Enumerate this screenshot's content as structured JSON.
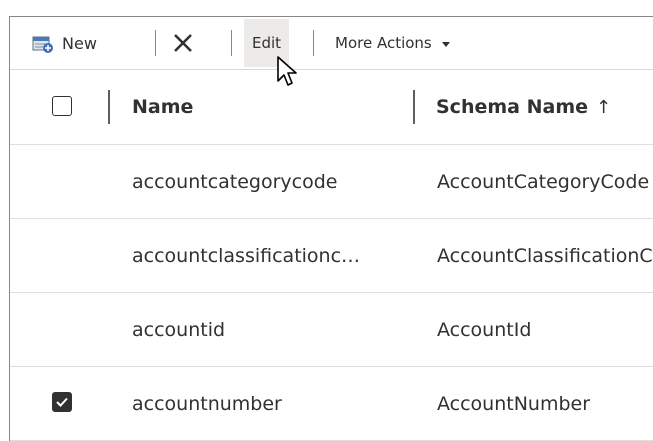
{
  "toolbar": {
    "new_label": "New",
    "edit_label": "Edit",
    "more_label": "More Actions"
  },
  "grid": {
    "columns": [
      "Name",
      "Schema Name"
    ],
    "sort_indicator": "↑",
    "rows": [
      {
        "name": "accountcategorycode",
        "schema": "AccountCategoryCode",
        "checked": false
      },
      {
        "name": "accountclassificationc…",
        "schema": "AccountClassificationCode",
        "checked": false
      },
      {
        "name": "accountid",
        "schema": "AccountId",
        "checked": false
      },
      {
        "name": "accountnumber",
        "schema": "AccountNumber",
        "checked": true
      }
    ]
  }
}
